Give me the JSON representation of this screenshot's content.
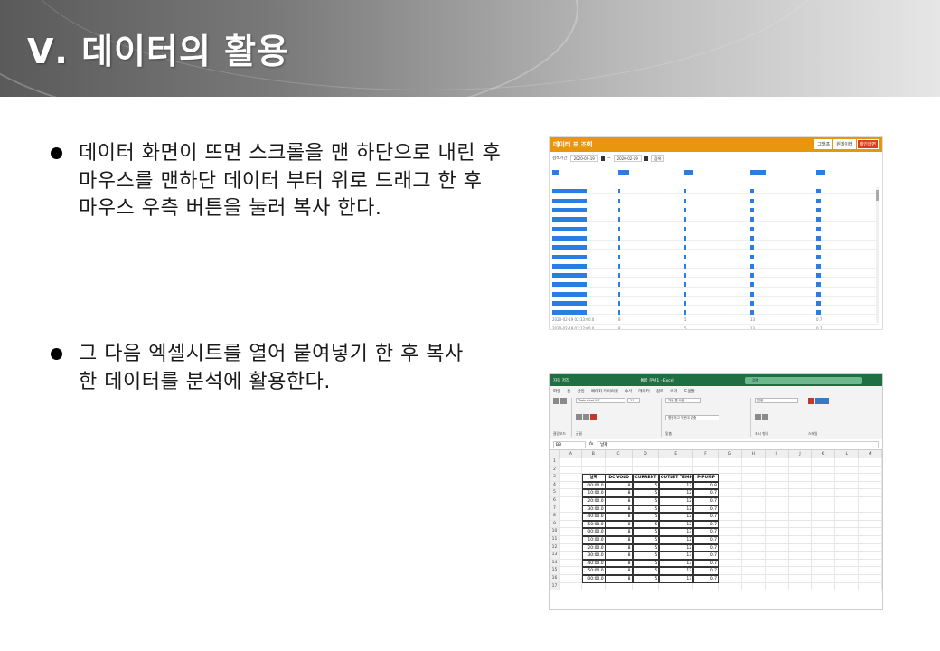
{
  "header": {
    "title": "Ⅴ. 데이터의 활용"
  },
  "bullets": [
    {
      "text": "데이터 화면이 뜨면 스크롤을 맨 하단으로 내린 후 마우스를 맨하단 데이터 부터 위로 드래그 한 후 마우스 우측 버튼을 눌러 복사 한다."
    },
    {
      "text": "그 다음 엑셀시트를 열어 붙여넣기 한 후 복사한 데이터를 분석에 활용한다."
    }
  ],
  "screenshot1": {
    "title": "데이터 표 조회",
    "buttons": [
      "그래프",
      "원데이터",
      "메인화면"
    ],
    "filter_label": "검색기간",
    "date_from": "2020-02-19",
    "date_to": "2020-02-19",
    "search": "검색",
    "plain_rows": [
      [
        "2020-02-19 02:13:00.0",
        "8",
        "5",
        "13",
        "0.7"
      ],
      [
        "2020-02-19 02:12:00.0",
        "8",
        "5",
        "13",
        "0.7"
      ]
    ]
  },
  "screenshot2": {
    "autosave": "자동 저장",
    "doc_title": "통합 문서1 - Excel",
    "search_placeholder": "검색",
    "menu": [
      "파일",
      "홈",
      "삽입",
      "페이지 레이아웃",
      "수식",
      "데이터",
      "검토",
      "보기",
      "도움말"
    ],
    "font_name": "Trebuchet MS",
    "font_size": "11",
    "wrap_text": "자동 줄 바꿈",
    "merge": "병합하고 가운데 맞춤",
    "number_format": "일반",
    "groups": [
      "클립보드",
      "글꼴",
      "맞춤",
      "표시 형식",
      "스타일"
    ],
    "name_box": "B3",
    "formula": "날짜",
    "columns": [
      "A",
      "B",
      "C",
      "D",
      "E",
      "F",
      "G",
      "H",
      "I",
      "J",
      "K",
      "L",
      "M"
    ],
    "table_headers": [
      "날짜",
      "DC VOLD",
      "CURRENT",
      "OUTLET TEMP",
      "P-PUMP"
    ],
    "table_rows": [
      [
        "00:00.0",
        "8",
        "5",
        "12",
        "0.8"
      ],
      [
        "10:00.0",
        "8",
        "5",
        "12",
        "0.7"
      ],
      [
        "20:00.0",
        "8",
        "5",
        "12",
        "0.7"
      ],
      [
        "30:00.0",
        "8",
        "5",
        "12",
        "0.7"
      ],
      [
        "40:00.0",
        "8",
        "5",
        "12",
        "0.7"
      ],
      [
        "50:00.0",
        "8",
        "5",
        "12",
        "0.7"
      ],
      [
        "00:00.0",
        "8",
        "5",
        "13",
        "0.7"
      ],
      [
        "10:00.0",
        "8",
        "5",
        "12",
        "0.7"
      ],
      [
        "20:00.0",
        "8",
        "5",
        "12",
        "0.7"
      ],
      [
        "30:00.0",
        "8",
        "5",
        "13",
        "0.7"
      ],
      [
        "40:00.0",
        "8",
        "5",
        "13",
        "0.7"
      ],
      [
        "50:00.0",
        "8",
        "5",
        "13",
        "0.7"
      ],
      [
        "00:00.0",
        "8",
        "5",
        "13",
        "0.7"
      ]
    ]
  }
}
